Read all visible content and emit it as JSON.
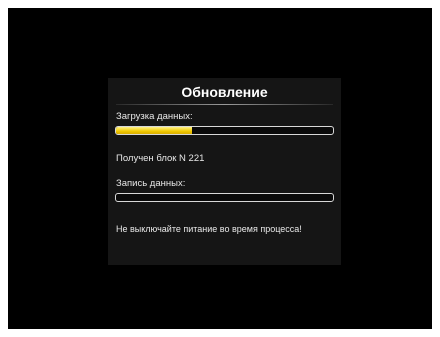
{
  "dialog": {
    "title": "Обновление",
    "download_label": "Загрузка данных:",
    "download_progress": 0.35,
    "status_text": "Получен блок N 221",
    "write_label": "Запись данных:",
    "write_progress": 0,
    "warning_text": "Не выключайте питание во время процесса!"
  },
  "colors": {
    "screen_background": "#000000",
    "dialog_background": "#151515",
    "progress_fill": "#f0c800",
    "text": "#e8e8e8"
  }
}
